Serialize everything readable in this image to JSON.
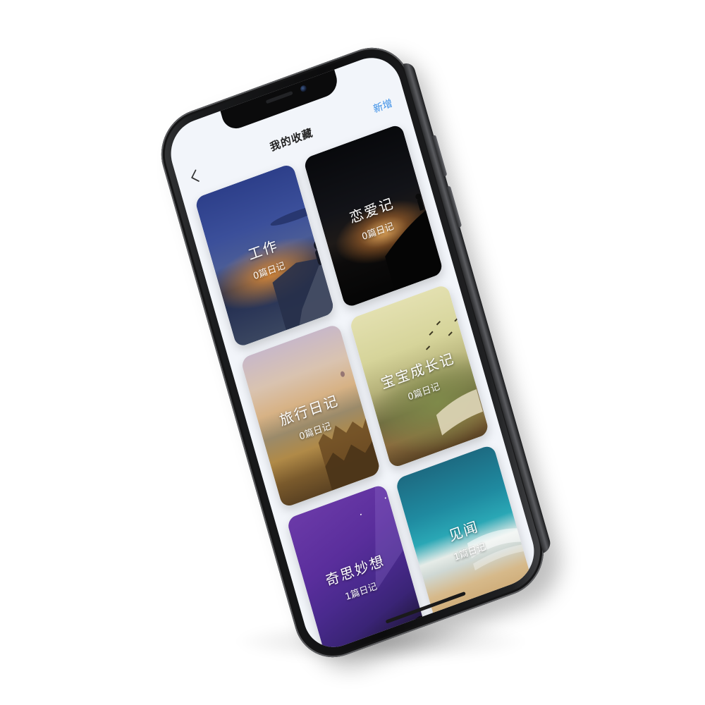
{
  "nav": {
    "back_icon": "chevron-left-icon",
    "title": "我的收藏",
    "add_label": "新增"
  },
  "cards": [
    {
      "title": "工作",
      "count": "0篇日记"
    },
    {
      "title": "恋爱记",
      "count": "0篇日记"
    },
    {
      "title": "旅行日记",
      "count": "0篇日记"
    },
    {
      "title": "宝宝成长记",
      "count": "0篇日记"
    },
    {
      "title": "奇思妙想",
      "count": "1篇日记"
    },
    {
      "title": "见闻",
      "count": "1篇日记"
    }
  ],
  "colors": {
    "accent": "#3a8ee6",
    "screen_bg": "#f2f5fa",
    "phone_body": "#0c0c0d"
  }
}
